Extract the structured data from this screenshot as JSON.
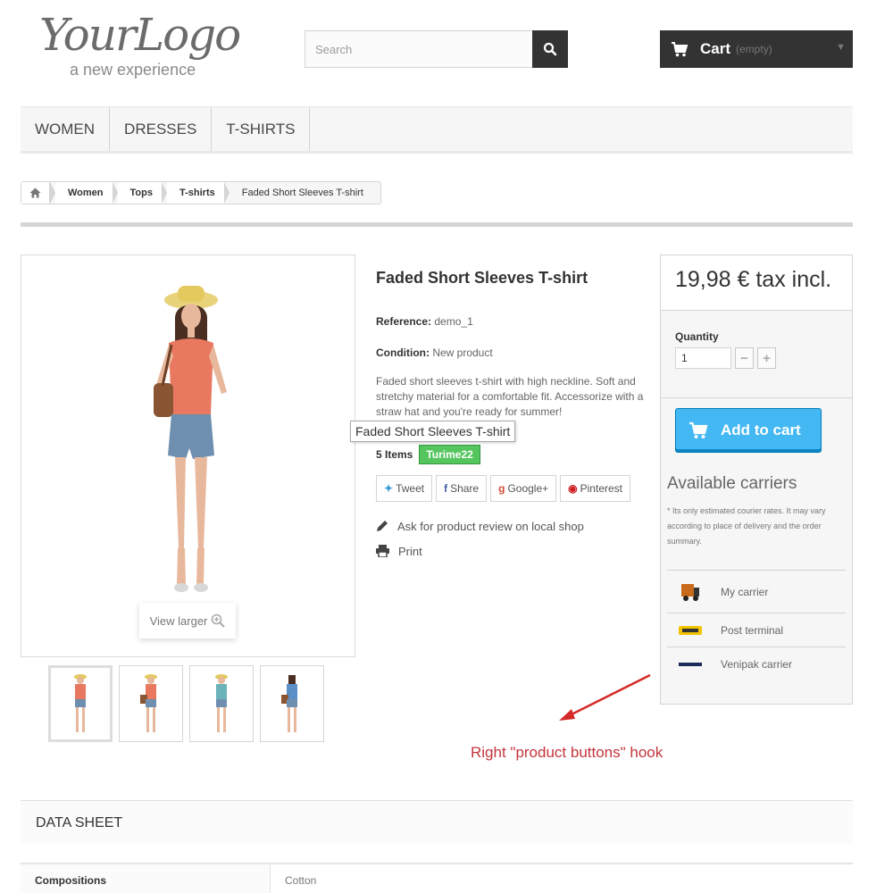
{
  "header": {
    "logo_main": "YourLogo",
    "logo_sub": "a new experience",
    "search_placeholder": "Search",
    "cart_label": "Cart",
    "cart_status": "(empty)"
  },
  "menu": {
    "items": [
      "WOMEN",
      "DRESSES",
      "T-SHIRTS"
    ]
  },
  "breadcrumb": {
    "items": [
      "Women",
      "Tops",
      "T-shirts",
      "Faded Short Sleeves T-shirt"
    ]
  },
  "product": {
    "title": "Faded Short Sleeves T-shirt",
    "reference_label": "Reference:",
    "reference_value": "demo_1",
    "condition_label": "Condition:",
    "condition_value": "New product",
    "description": "Faded short sleeves t-shirt with high neckline. Soft and stretchy material for a comfortable fit. Accessorize with a straw hat and you're ready for summer!",
    "tooltip": "Faded Short Sleeves T-shirt",
    "stock_count": "5 Items",
    "stock_badge": "Turime22",
    "view_larger": "View larger"
  },
  "social": {
    "tweet": "Tweet",
    "share": "Share",
    "google": "Google+",
    "pinterest": "Pinterest"
  },
  "extra": {
    "review": "Ask for product review on local shop",
    "print": "Print"
  },
  "buy_box": {
    "price": "19,98 € tax incl.",
    "quantity_label": "Quantity",
    "quantity_value": "1",
    "add_to_cart": "Add to cart",
    "carriers_title": "Available carriers",
    "carriers_note": "* Its only estimated courier rates. It may vary according to place of delivery and the order summary.",
    "carriers": [
      "My carrier",
      "Post terminal",
      "Venipak carrier"
    ]
  },
  "annotation": {
    "text": "Right \"product buttons\" hook"
  },
  "datasheet": {
    "title": "DATA SHEET",
    "rows": [
      {
        "key": "Compositions",
        "value": "Cotton"
      }
    ]
  },
  "colors": {
    "accent": "#43b8f3",
    "dark": "#333333",
    "stock_green": "#55c65e",
    "annotation_red": "#c4353d"
  }
}
